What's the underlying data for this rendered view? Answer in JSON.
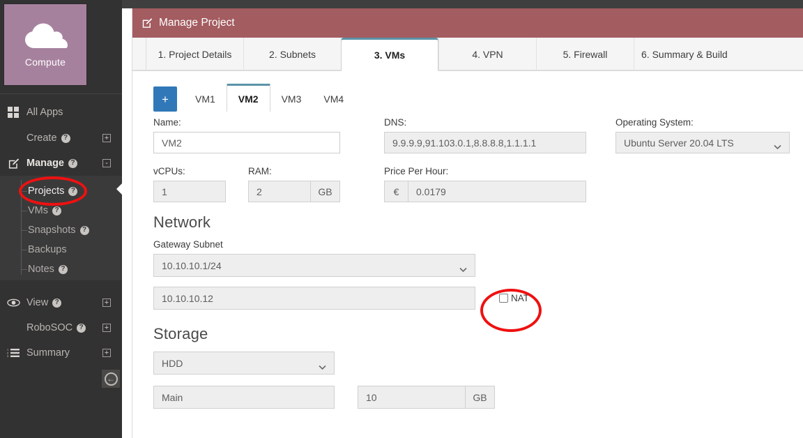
{
  "sidebar": {
    "app_tile": {
      "label": "Compute",
      "icon": "cloud-icon",
      "color": "#a6819e"
    },
    "all_apps": {
      "label": "All Apps",
      "icon": "grid-icon"
    },
    "items": [
      {
        "label": "Create",
        "icon": "",
        "help": "?",
        "expander": "+"
      },
      {
        "label": "Manage",
        "icon": "pencil-square-icon",
        "help": "?",
        "expander": "-"
      }
    ],
    "submenu": [
      {
        "label": "Projects",
        "help": "?"
      },
      {
        "label": "VMs",
        "help": "?"
      },
      {
        "label": "Snapshots",
        "help": "?"
      },
      {
        "label": "Backups",
        "help": ""
      },
      {
        "label": "Notes",
        "help": "?"
      }
    ],
    "items_after": [
      {
        "label": "View",
        "icon": "eye-icon",
        "help": "?",
        "expander": "+"
      },
      {
        "label": "RoboSOC",
        "icon": "",
        "help": "?",
        "expander": "+"
      },
      {
        "label": "Summary",
        "icon": "ordered-list-icon",
        "help": "",
        "expander": "+"
      }
    ],
    "collapse_button": "←"
  },
  "panel": {
    "title": "Manage Project",
    "title_icon": "pencil-square-icon",
    "header_color": "#a35c60",
    "wizard_tabs": [
      {
        "label": "1. Project Details",
        "active": false
      },
      {
        "label": "2. Subnets",
        "active": false
      },
      {
        "label": "3. VMs",
        "active": true
      },
      {
        "label": "4. VPN",
        "active": false
      },
      {
        "label": "5. Firewall",
        "active": false
      },
      {
        "label": "6. Summary & Build",
        "active": false
      }
    ]
  },
  "vm_tabs": {
    "add_label": "+",
    "tabs": [
      {
        "label": "VM1",
        "active": false
      },
      {
        "label": "VM2",
        "active": true
      },
      {
        "label": "VM3",
        "active": false
      },
      {
        "label": "VM4",
        "active": false
      }
    ]
  },
  "form": {
    "name": {
      "label": "Name:",
      "value": "VM2"
    },
    "dns": {
      "label": "DNS:",
      "value": "9.9.9.9,91.103.0.1,8.8.8.8,1.1.1.1"
    },
    "operating_system": {
      "label": "Operating System:",
      "value": "Ubuntu Server 20.04 LTS"
    },
    "vcpus": {
      "label": "vCPUs:",
      "value": "1"
    },
    "ram": {
      "label": "RAM:",
      "value": "2",
      "unit": "GB"
    },
    "price_per_hour": {
      "label": "Price Per Hour:",
      "currency": "€",
      "value": "0.0179"
    }
  },
  "network": {
    "title": "Network",
    "gateway_subnet": {
      "label": "Gateway Subnet",
      "value": "10.10.10.1/24"
    },
    "ip_address": {
      "value": "10.10.10.12"
    },
    "nat": {
      "label": "NAT",
      "checked": false
    }
  },
  "storage": {
    "title": "Storage",
    "type": {
      "value": "HDD"
    },
    "disk_name": {
      "value": "Main"
    },
    "size": {
      "value": "10",
      "unit": "GB"
    }
  },
  "annotations": {
    "color": "#ee1111",
    "targets": [
      "Projects",
      "NAT"
    ]
  }
}
